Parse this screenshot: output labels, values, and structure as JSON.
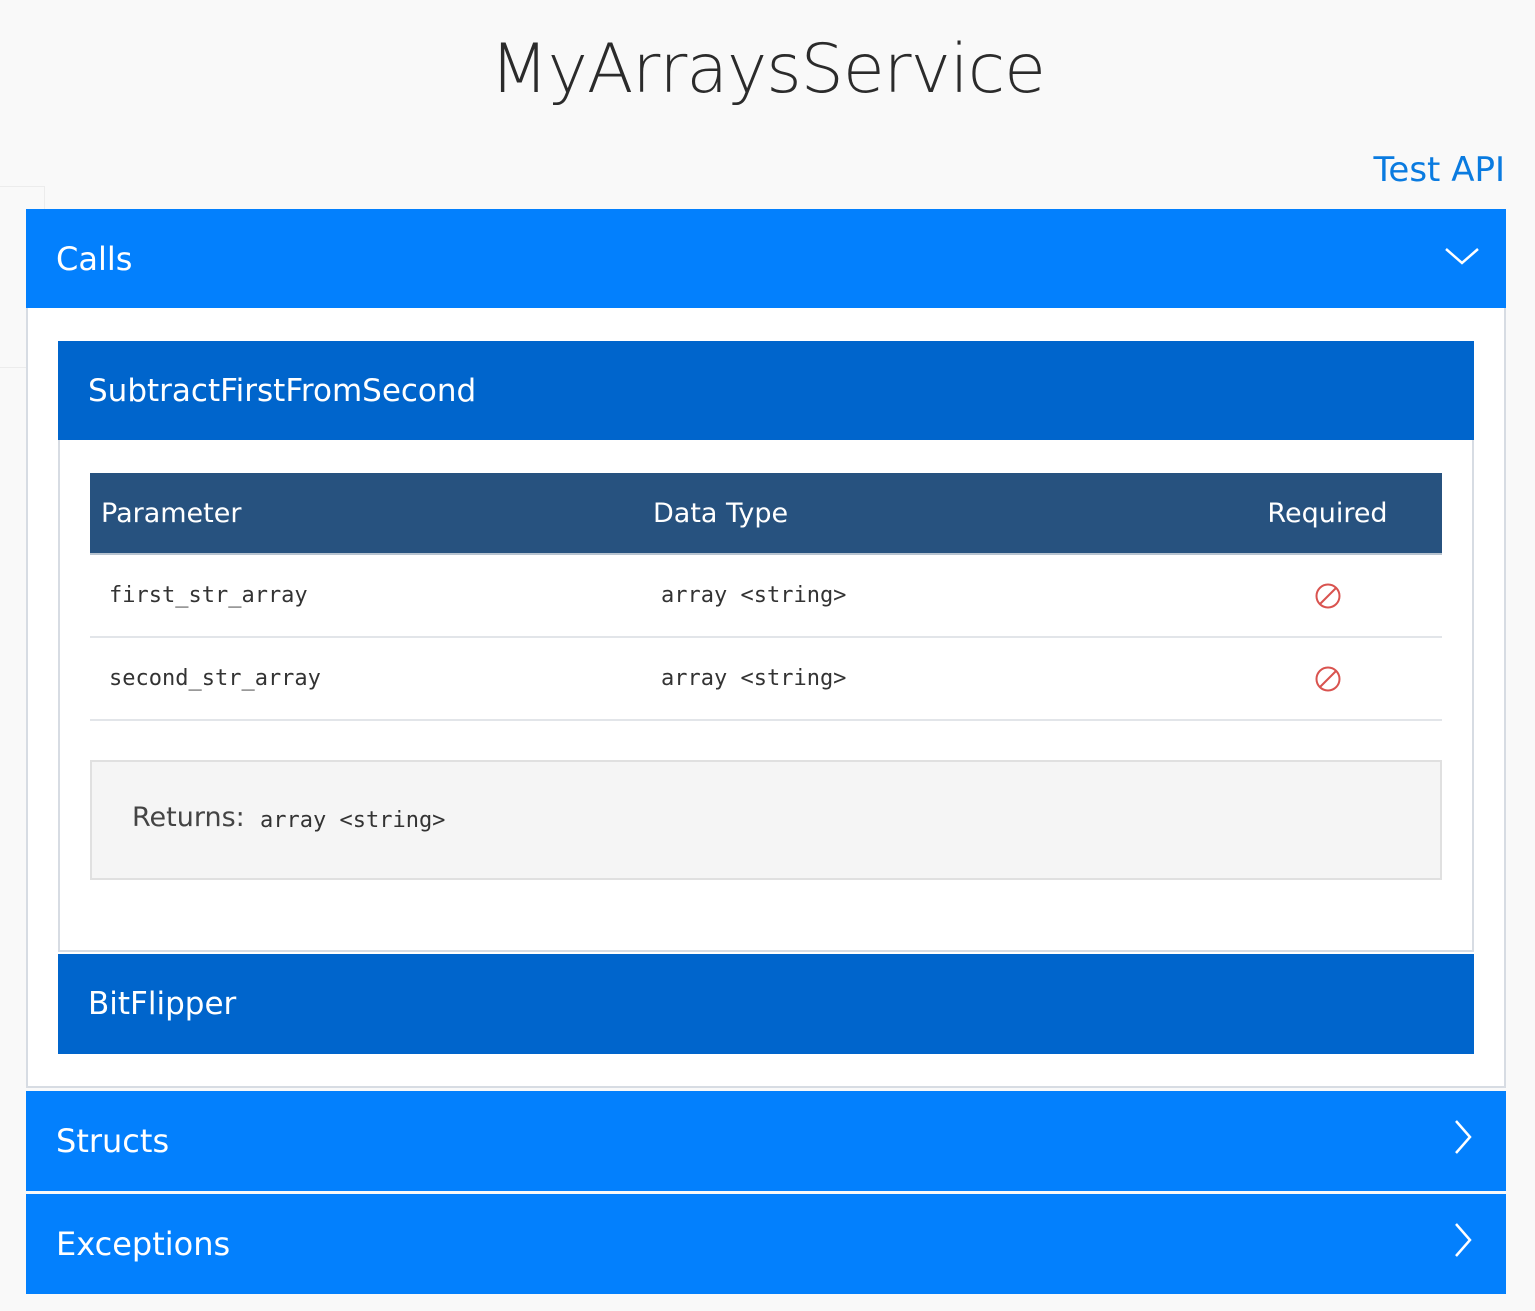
{
  "page": {
    "title": "MyArraysService",
    "test_api_label": "Test API"
  },
  "sections": {
    "calls": {
      "label": "Calls",
      "expanded": true,
      "calls": [
        {
          "name": "SubtractFirstFromSecond",
          "expanded": true,
          "table": {
            "headers": [
              "Parameter",
              "Data Type",
              "Required"
            ],
            "rows": [
              {
                "parameter": "first_str_array",
                "data_type": "array <string>",
                "required": false
              },
              {
                "parameter": "second_str_array",
                "data_type": "array <string>",
                "required": false
              }
            ]
          },
          "returns_label": "Returns:",
          "returns_type": "array <string>"
        },
        {
          "name": "BitFlipper",
          "expanded": false
        }
      ]
    },
    "structs": {
      "label": "Structs",
      "expanded": false
    },
    "exceptions": {
      "label": "Exceptions",
      "expanded": false
    }
  },
  "icons": {
    "expanded_chevron": "chevron-down-icon",
    "collapsed_chevron": "chevron-right-icon",
    "not_required": "not-required-icon"
  },
  "colors": {
    "section_header": "#0380fd",
    "call_header": "#0065cc",
    "table_header": "#27527f",
    "link": "#0a7be0",
    "not_required_icon": "#d9534f"
  }
}
